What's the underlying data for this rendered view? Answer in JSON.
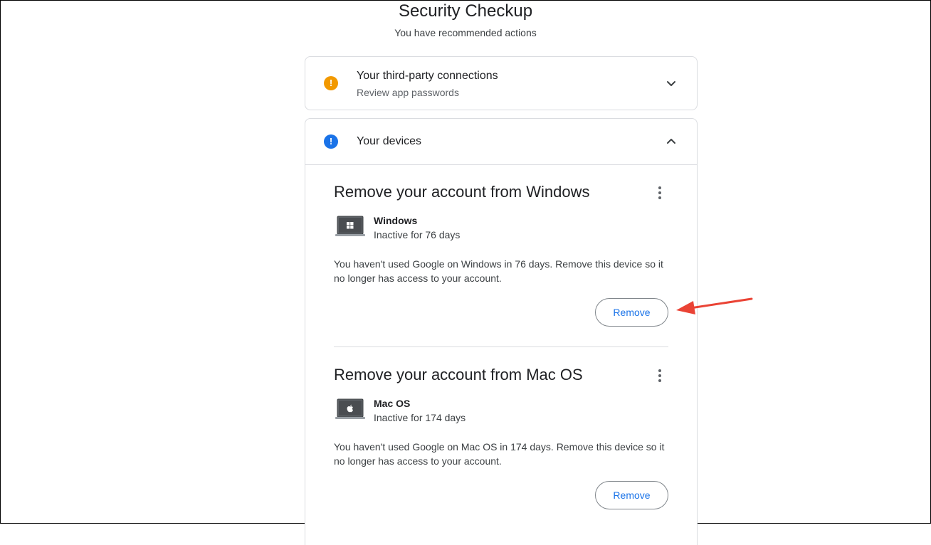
{
  "header": {
    "title": "Security Checkup",
    "subtitle": "You have recommended actions"
  },
  "cards": [
    {
      "title": "Your third-party connections",
      "subtitle": "Review app passwords",
      "status_icon": "warning-icon",
      "status_color": "#f29900",
      "state": "collapsed"
    },
    {
      "title": "Your devices",
      "status_icon": "info-icon",
      "status_color": "#1a73e8",
      "state": "expanded",
      "devices": [
        {
          "heading": "Remove your account from Windows",
          "name": "Windows",
          "status": "Inactive for 76 days",
          "description": "You haven't used Google on Windows in 76 days. Remove this device so it no longer has access to your account.",
          "button_label": "Remove",
          "os_icon": "windows-logo-icon"
        },
        {
          "heading": "Remove your account from Mac OS",
          "name": "Mac OS",
          "status": "Inactive for 174 days",
          "description": "You haven't used Google on Mac OS in 174 days. Remove this device so it no longer has access to your account.",
          "button_label": "Remove",
          "os_icon": "apple-logo-icon"
        }
      ]
    }
  ],
  "icons": {
    "status_mark": "!"
  },
  "colors": {
    "accent": "#1a73e8",
    "warning": "#f29900",
    "annotation_arrow": "#ea4335"
  }
}
